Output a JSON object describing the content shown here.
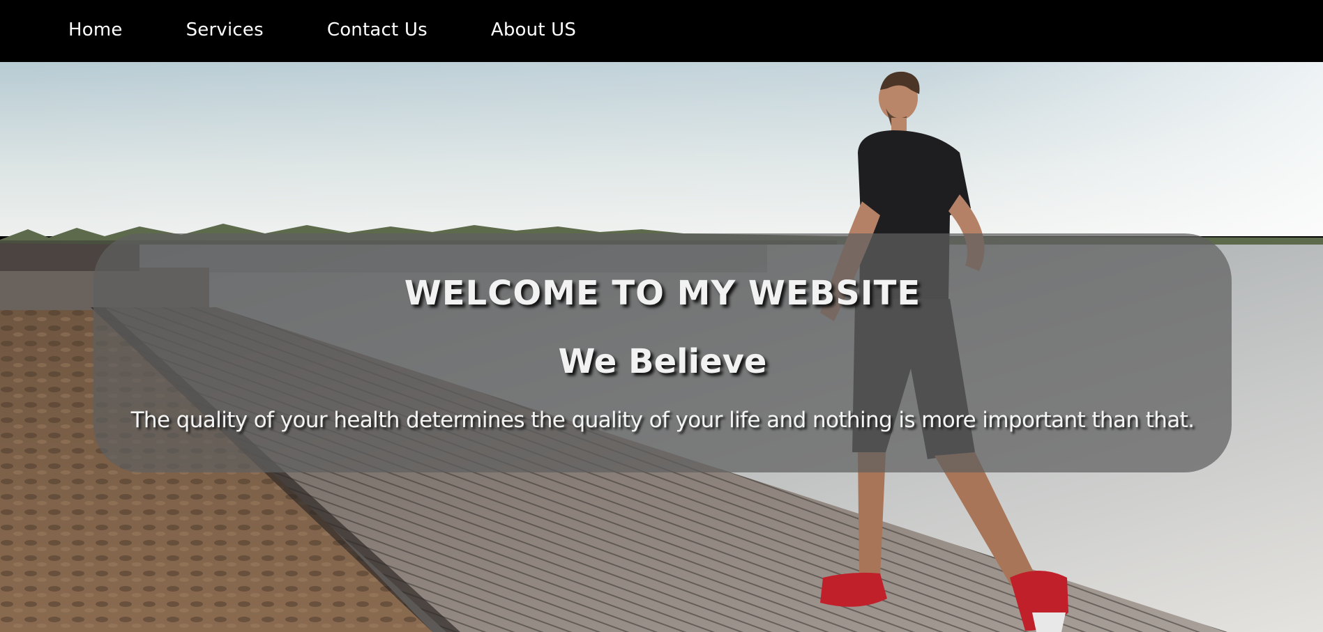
{
  "nav": {
    "items": [
      {
        "label": "Home"
      },
      {
        "label": "Services"
      },
      {
        "label": "Contact Us"
      },
      {
        "label": "About US"
      }
    ]
  },
  "hero": {
    "title": "WELCOME TO MY WEBSITE",
    "subtitle": "We Believe",
    "text": "The quality of your health determines the quality of your life and nothing is more important than that.",
    "image_subject": "man-jogging-on-boardwalk-by-lake"
  },
  "colors": {
    "navbar": "#000000",
    "nav_text": "#ffffff",
    "overlay": "#5f5f5f",
    "hero_text": "#f2f2f2"
  }
}
